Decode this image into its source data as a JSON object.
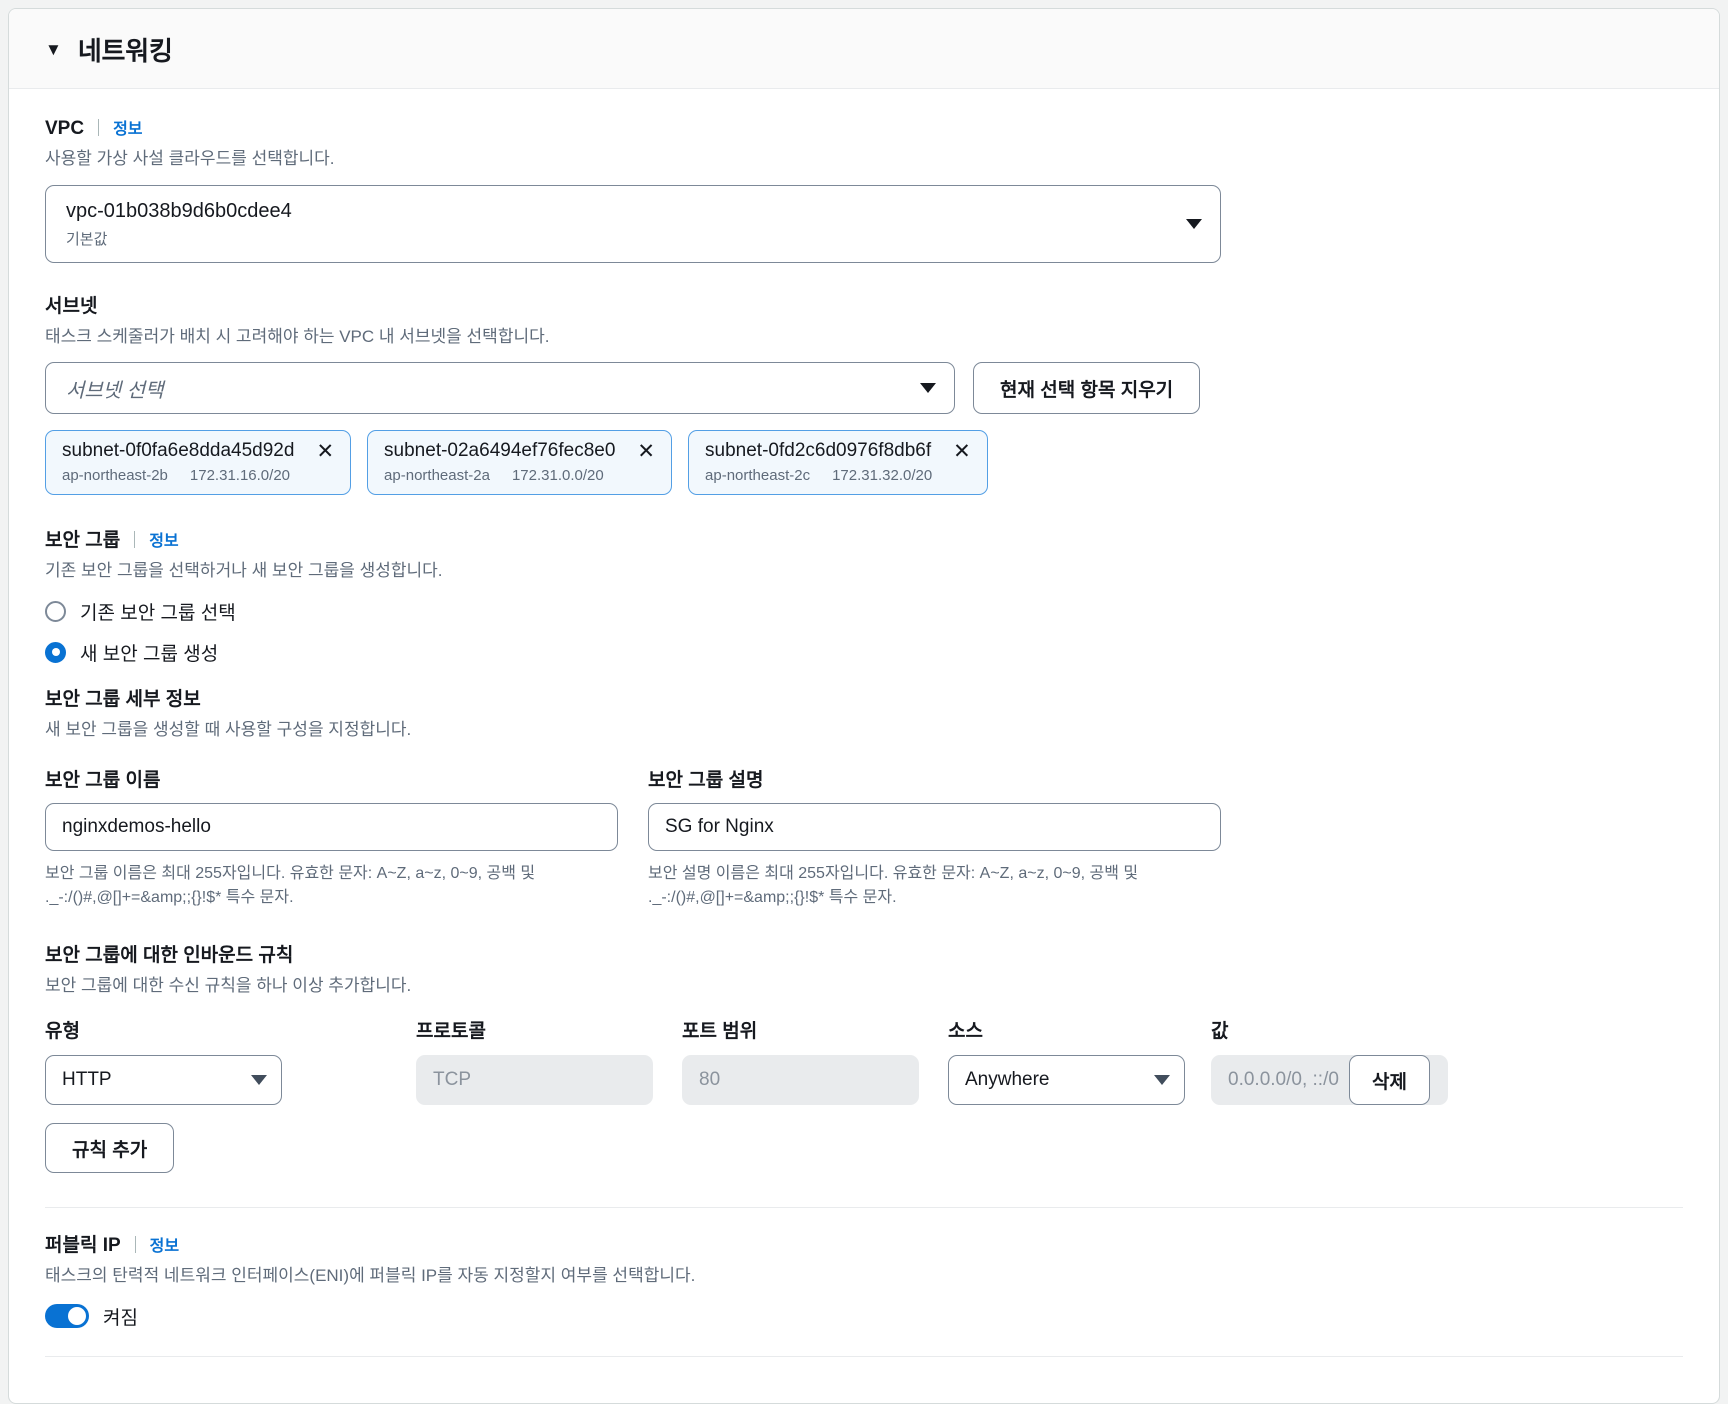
{
  "section": {
    "title": "네트워킹",
    "collapse_icon": "caret-down-icon"
  },
  "vpc": {
    "label": "VPC",
    "info_label": "정보",
    "description": "사용할 가상 사설 클라우드를 선택합니다.",
    "selected_value": "vpc-01b038b9d6b0cdee4",
    "selected_sub": "기본값"
  },
  "subnet": {
    "label": "서브넷",
    "description": "태스크 스케줄러가 배치 시 고려해야 하는 VPC 내 서브넷을 선택합니다.",
    "placeholder": "서브넷 선택",
    "clear_button": "현재 선택 항목 지우기",
    "chips": [
      {
        "id": "subnet-0f0fa6e8dda45d92d",
        "az": "ap-northeast-2b",
        "cidr": "172.31.16.0/20",
        "remove_icon": "close-icon"
      },
      {
        "id": "subnet-02a6494ef76fec8e0",
        "az": "ap-northeast-2a",
        "cidr": "172.31.0.0/20",
        "remove_icon": "close-icon"
      },
      {
        "id": "subnet-0fd2c6d0976f8db6f",
        "az": "ap-northeast-2c",
        "cidr": "172.31.32.0/20",
        "remove_icon": "close-icon"
      }
    ]
  },
  "security_group": {
    "label": "보안 그룹",
    "info_label": "정보",
    "description": "기존 보안 그룹을 선택하거나 새 보안 그룹을 생성합니다.",
    "options": [
      {
        "label": "기존 보안 그룹 선택",
        "selected": false
      },
      {
        "label": "새 보안 그룹 생성",
        "selected": true
      }
    ],
    "details_heading": "보안 그룹 세부 정보",
    "details_description": "새 보안 그룹을 생성할 때 사용할 구성을 지정합니다.",
    "name_label": "보안 그룹 이름",
    "name_value": "nginxdemos-hello",
    "name_constraint": "보안 그룹 이름은 최대 255자입니다. 유효한 문자: A~Z, a~z, 0~9, 공백 및 ._-:/()#,@[]+=&amp;;{}!$* 특수 문자.",
    "desc_label": "보안 그룹 설명",
    "desc_value": "SG for Nginx",
    "desc_constraint": "보안 설명 이름은 최대 255자입니다. 유효한 문자: A~Z, a~z, 0~9, 공백 및 ._-:/()#,@[]+=&amp;;{}!$* 특수 문자."
  },
  "inbound_rules": {
    "heading": "보안 그룹에 대한 인바운드 규칙",
    "description": "보안 그룹에 대한 수신 규칙을 하나 이상 추가합니다.",
    "columns": {
      "type": "유형",
      "protocol": "프로토콜",
      "port_range": "포트 범위",
      "source": "소스",
      "value": "값"
    },
    "rows": [
      {
        "type": "HTTP",
        "protocol": "TCP",
        "port_range": "80",
        "source": "Anywhere",
        "value": "0.0.0.0/0, ::/0",
        "delete_label": "삭제"
      }
    ],
    "add_rule_label": "규칙 추가"
  },
  "public_ip": {
    "label": "퍼블릭 IP",
    "info_label": "정보",
    "description": "태스크의 탄력적 네트워크 인터페이스(ENI)에 퍼블릭 IP를 자동 지정할지 여부를 선택합니다.",
    "toggle_state_label": "켜짐",
    "toggle_on": true
  },
  "colors": {
    "accent": "#0972d3",
    "chip_border": "#539fe5",
    "chip_bg": "#f2f8fd",
    "text": "#16191f",
    "muted": "#5f6b7a",
    "border": "#7d8998",
    "disabled_bg": "#e9ebed"
  }
}
